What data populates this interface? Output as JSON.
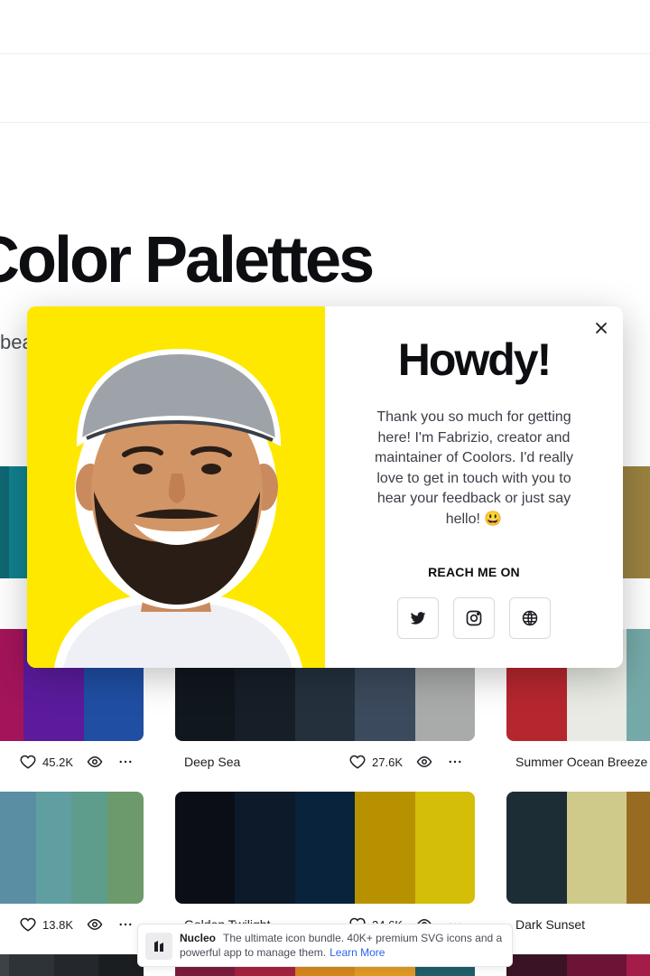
{
  "hero": {
    "title": "Color Palettes",
    "subtitle_fragment": "bea"
  },
  "modal": {
    "heading": "Howdy!",
    "message": "Thank you so much for getting here! I'm Fabrizio, creator and maintainer of Coolors. I'd really love to get in touch with you to hear your feedback or just say hello! 😃",
    "reach_label": "REACH ME ON",
    "social": [
      "twitter-icon",
      "instagram-icon",
      "globe-icon"
    ],
    "photo_bg": "#ffe800"
  },
  "palettes": {
    "row1": [
      {
        "colors": [
          "#0f6873",
          "#10828f"
        ]
      },
      {
        "colors": [
          "#136c7a",
          "#0f5f6b",
          "#0c4d58"
        ]
      },
      {
        "colors": [
          "#9a8240"
        ]
      }
    ],
    "row2": [
      {
        "colors": [
          "#a3145a",
          "#5b1b9c",
          "#1f4ea3"
        ],
        "likes": "45.2K"
      },
      {
        "name": "Deep Sea",
        "colors": [
          "#10171d",
          "#161e27",
          "#24313d",
          "#3b4a5c",
          "#a9aaaa"
        ],
        "likes": "27.6K"
      },
      {
        "name": "Summer Ocean Breeze",
        "colors": [
          "#b6262f",
          "#e8eae3",
          "#75a9a8"
        ]
      }
    ],
    "row3": [
      {
        "colors": [
          "#6b85a0",
          "#5a8fa3",
          "#5f9ea1",
          "#5e9c8c",
          "#6c9a6c"
        ],
        "likes": "13.8K"
      },
      {
        "name": "Golden Twilight",
        "colors": [
          "#0b0e16",
          "#0c1a29",
          "#08233b",
          "#b89100",
          "#d4be08"
        ],
        "likes": "24.6K"
      },
      {
        "name": "Dark Sunset",
        "colors": [
          "#1d2d35",
          "#cfc98a",
          "#986b23"
        ]
      }
    ]
  },
  "ad": {
    "brand": "Nucleo",
    "text": "The ultimate icon bundle. 40K+ premium SVG icons and a powerful app to manage them.",
    "link": "Learn More"
  }
}
